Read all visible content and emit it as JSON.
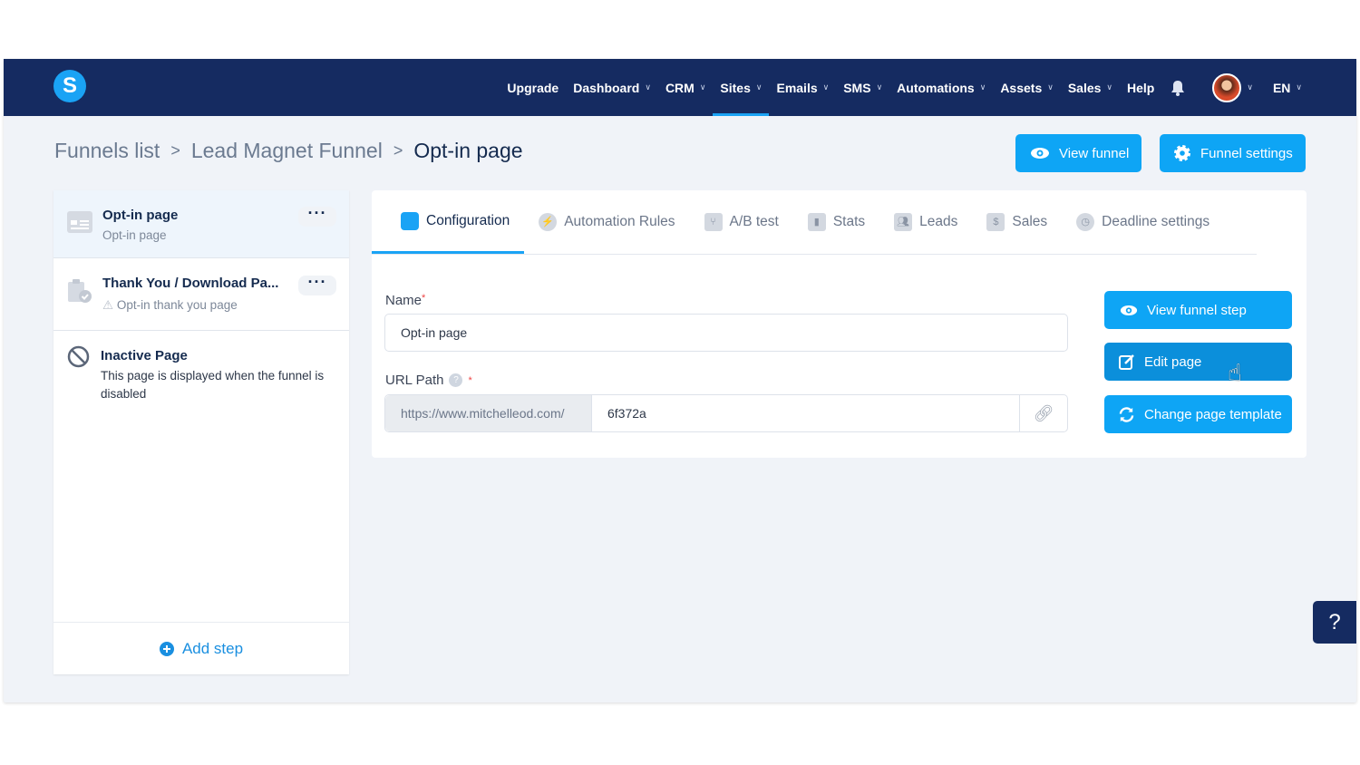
{
  "nav": {
    "logo": "S",
    "items": [
      {
        "label": "Upgrade",
        "chev": false
      },
      {
        "label": "Dashboard",
        "chev": true
      },
      {
        "label": "CRM",
        "chev": true
      },
      {
        "label": "Sites",
        "chev": true,
        "active": true
      },
      {
        "label": "Emails",
        "chev": true
      },
      {
        "label": "SMS",
        "chev": true
      },
      {
        "label": "Automations",
        "chev": true
      },
      {
        "label": "Assets",
        "chev": true
      },
      {
        "label": "Sales",
        "chev": true
      },
      {
        "label": "Help",
        "chev": false
      }
    ],
    "lang": "EN"
  },
  "breadcrumb": [
    "Funnels list",
    "Lead Magnet Funnel",
    "Opt-in page"
  ],
  "header_buttons": {
    "view_funnel": "View funnel",
    "funnel_settings": "Funnel settings"
  },
  "steps": [
    {
      "title": "Opt-in page",
      "sub": "Opt-in page"
    },
    {
      "title": "Thank You / Download Pa...",
      "sub": "Opt-in thank you page"
    }
  ],
  "inactive": {
    "title": "Inactive Page",
    "desc": "This page is displayed when the funnel is disabled"
  },
  "add_step": "Add step",
  "tabs": [
    "Configuration",
    "Automation Rules",
    "A/B test",
    "Stats",
    "Leads",
    "Sales",
    "Deadline settings"
  ],
  "form": {
    "name_label": "Name",
    "name_value": "Opt-in page",
    "url_label": "URL Path",
    "url_prefix": "https://www.mitchelleod.com/",
    "url_value": "6f372a",
    "required": "*"
  },
  "actions": {
    "view_step": "View funnel step",
    "edit": "Edit page",
    "change_template": "Change page template"
  },
  "help": "?",
  "colors": {
    "nav": "#152b61",
    "accent": "#0ea5f5"
  }
}
